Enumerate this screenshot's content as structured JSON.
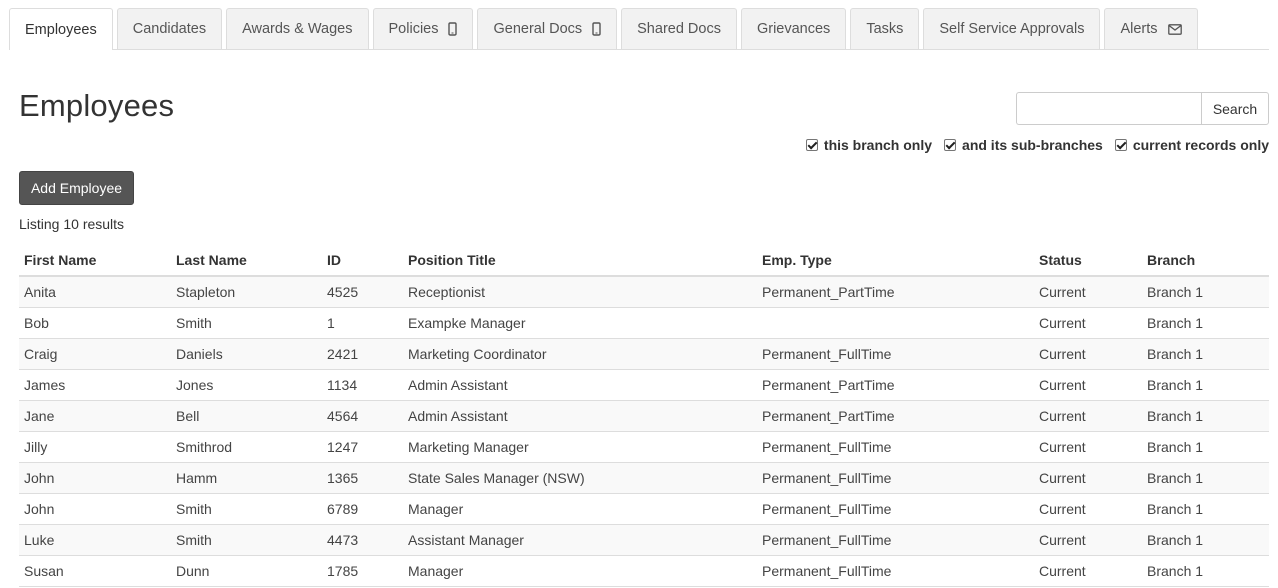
{
  "tabs": [
    {
      "label": "Employees",
      "active": true,
      "icon": null
    },
    {
      "label": "Candidates",
      "active": false,
      "icon": null
    },
    {
      "label": "Awards & Wages",
      "active": false,
      "icon": null
    },
    {
      "label": "Policies",
      "active": false,
      "icon": "mobile-icon"
    },
    {
      "label": "General Docs",
      "active": false,
      "icon": "mobile-icon"
    },
    {
      "label": "Shared Docs",
      "active": false,
      "icon": null
    },
    {
      "label": "Grievances",
      "active": false,
      "icon": null
    },
    {
      "label": "Tasks",
      "active": false,
      "icon": null
    },
    {
      "label": "Self Service Approvals",
      "active": false,
      "icon": null
    },
    {
      "label": "Alerts",
      "active": false,
      "icon": "envelope-icon"
    }
  ],
  "page": {
    "title": "Employees",
    "add_button": "Add Employee",
    "listing": "Listing 10 results"
  },
  "search": {
    "value": "",
    "placeholder": "",
    "button_label": "Search"
  },
  "filters": [
    {
      "label": "this branch only",
      "checked": true
    },
    {
      "label": "and its sub-branches",
      "checked": true
    },
    {
      "label": "current records only",
      "checked": true
    }
  ],
  "table": {
    "columns": [
      "First Name",
      "Last Name",
      "ID",
      "Position Title",
      "Emp. Type",
      "Status",
      "Branch"
    ],
    "rows": [
      [
        "Anita",
        "Stapleton",
        "4525",
        "Receptionist",
        "Permanent_PartTime",
        "Current",
        "Branch 1"
      ],
      [
        "Bob",
        "Smith",
        "1",
        "Exampke Manager",
        "",
        "Current",
        "Branch 1"
      ],
      [
        "Craig",
        "Daniels",
        "2421",
        "Marketing Coordinator",
        "Permanent_FullTime",
        "Current",
        "Branch 1"
      ],
      [
        "James",
        "Jones",
        "1134",
        "Admin Assistant",
        "Permanent_PartTime",
        "Current",
        "Branch 1"
      ],
      [
        "Jane",
        "Bell",
        "4564",
        "Admin Assistant",
        "Permanent_PartTime",
        "Current",
        "Branch 1"
      ],
      [
        "Jilly",
        "Smithrod",
        "1247",
        "Marketing Manager",
        "Permanent_FullTime",
        "Current",
        "Branch 1"
      ],
      [
        "John",
        "Hamm",
        "1365",
        "State Sales Manager (NSW)",
        "Permanent_FullTime",
        "Current",
        "Branch 1"
      ],
      [
        "John",
        "Smith",
        "6789",
        "Manager",
        "Permanent_FullTime",
        "Current",
        "Branch 1"
      ],
      [
        "Luke",
        "Smith",
        "4473",
        "Assistant Manager",
        "Permanent_FullTime",
        "Current",
        "Branch 1"
      ],
      [
        "Susan",
        "Dunn",
        "1785",
        "Manager",
        "Permanent_FullTime",
        "Current",
        "Branch 1"
      ]
    ]
  }
}
